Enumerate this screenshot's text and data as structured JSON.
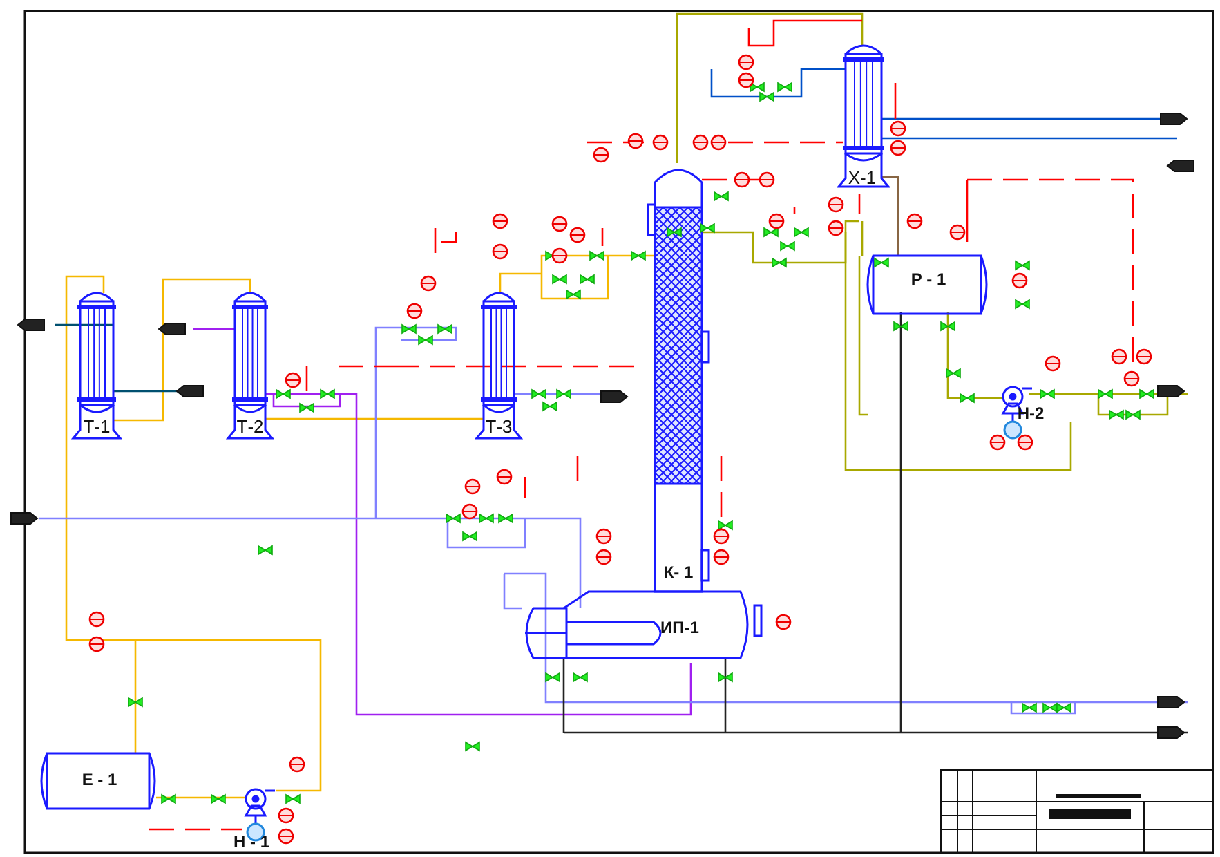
{
  "equipment": [
    {
      "kind": "exchanger",
      "label": "Т-1"
    },
    {
      "kind": "exchanger",
      "label": "Т-2"
    },
    {
      "kind": "exchanger",
      "label": "Т-3"
    },
    {
      "kind": "column",
      "label": "К- 1"
    },
    {
      "kind": "reboiler",
      "label": "ИП-1"
    },
    {
      "kind": "exchanger",
      "label": "Х-1"
    },
    {
      "kind": "drum",
      "label": "Р - 1"
    },
    {
      "kind": "drum",
      "label": "Е - 1"
    },
    {
      "kind": "pump",
      "label": "Н - 1"
    },
    {
      "kind": "pump",
      "label": "Н-2"
    }
  ]
}
